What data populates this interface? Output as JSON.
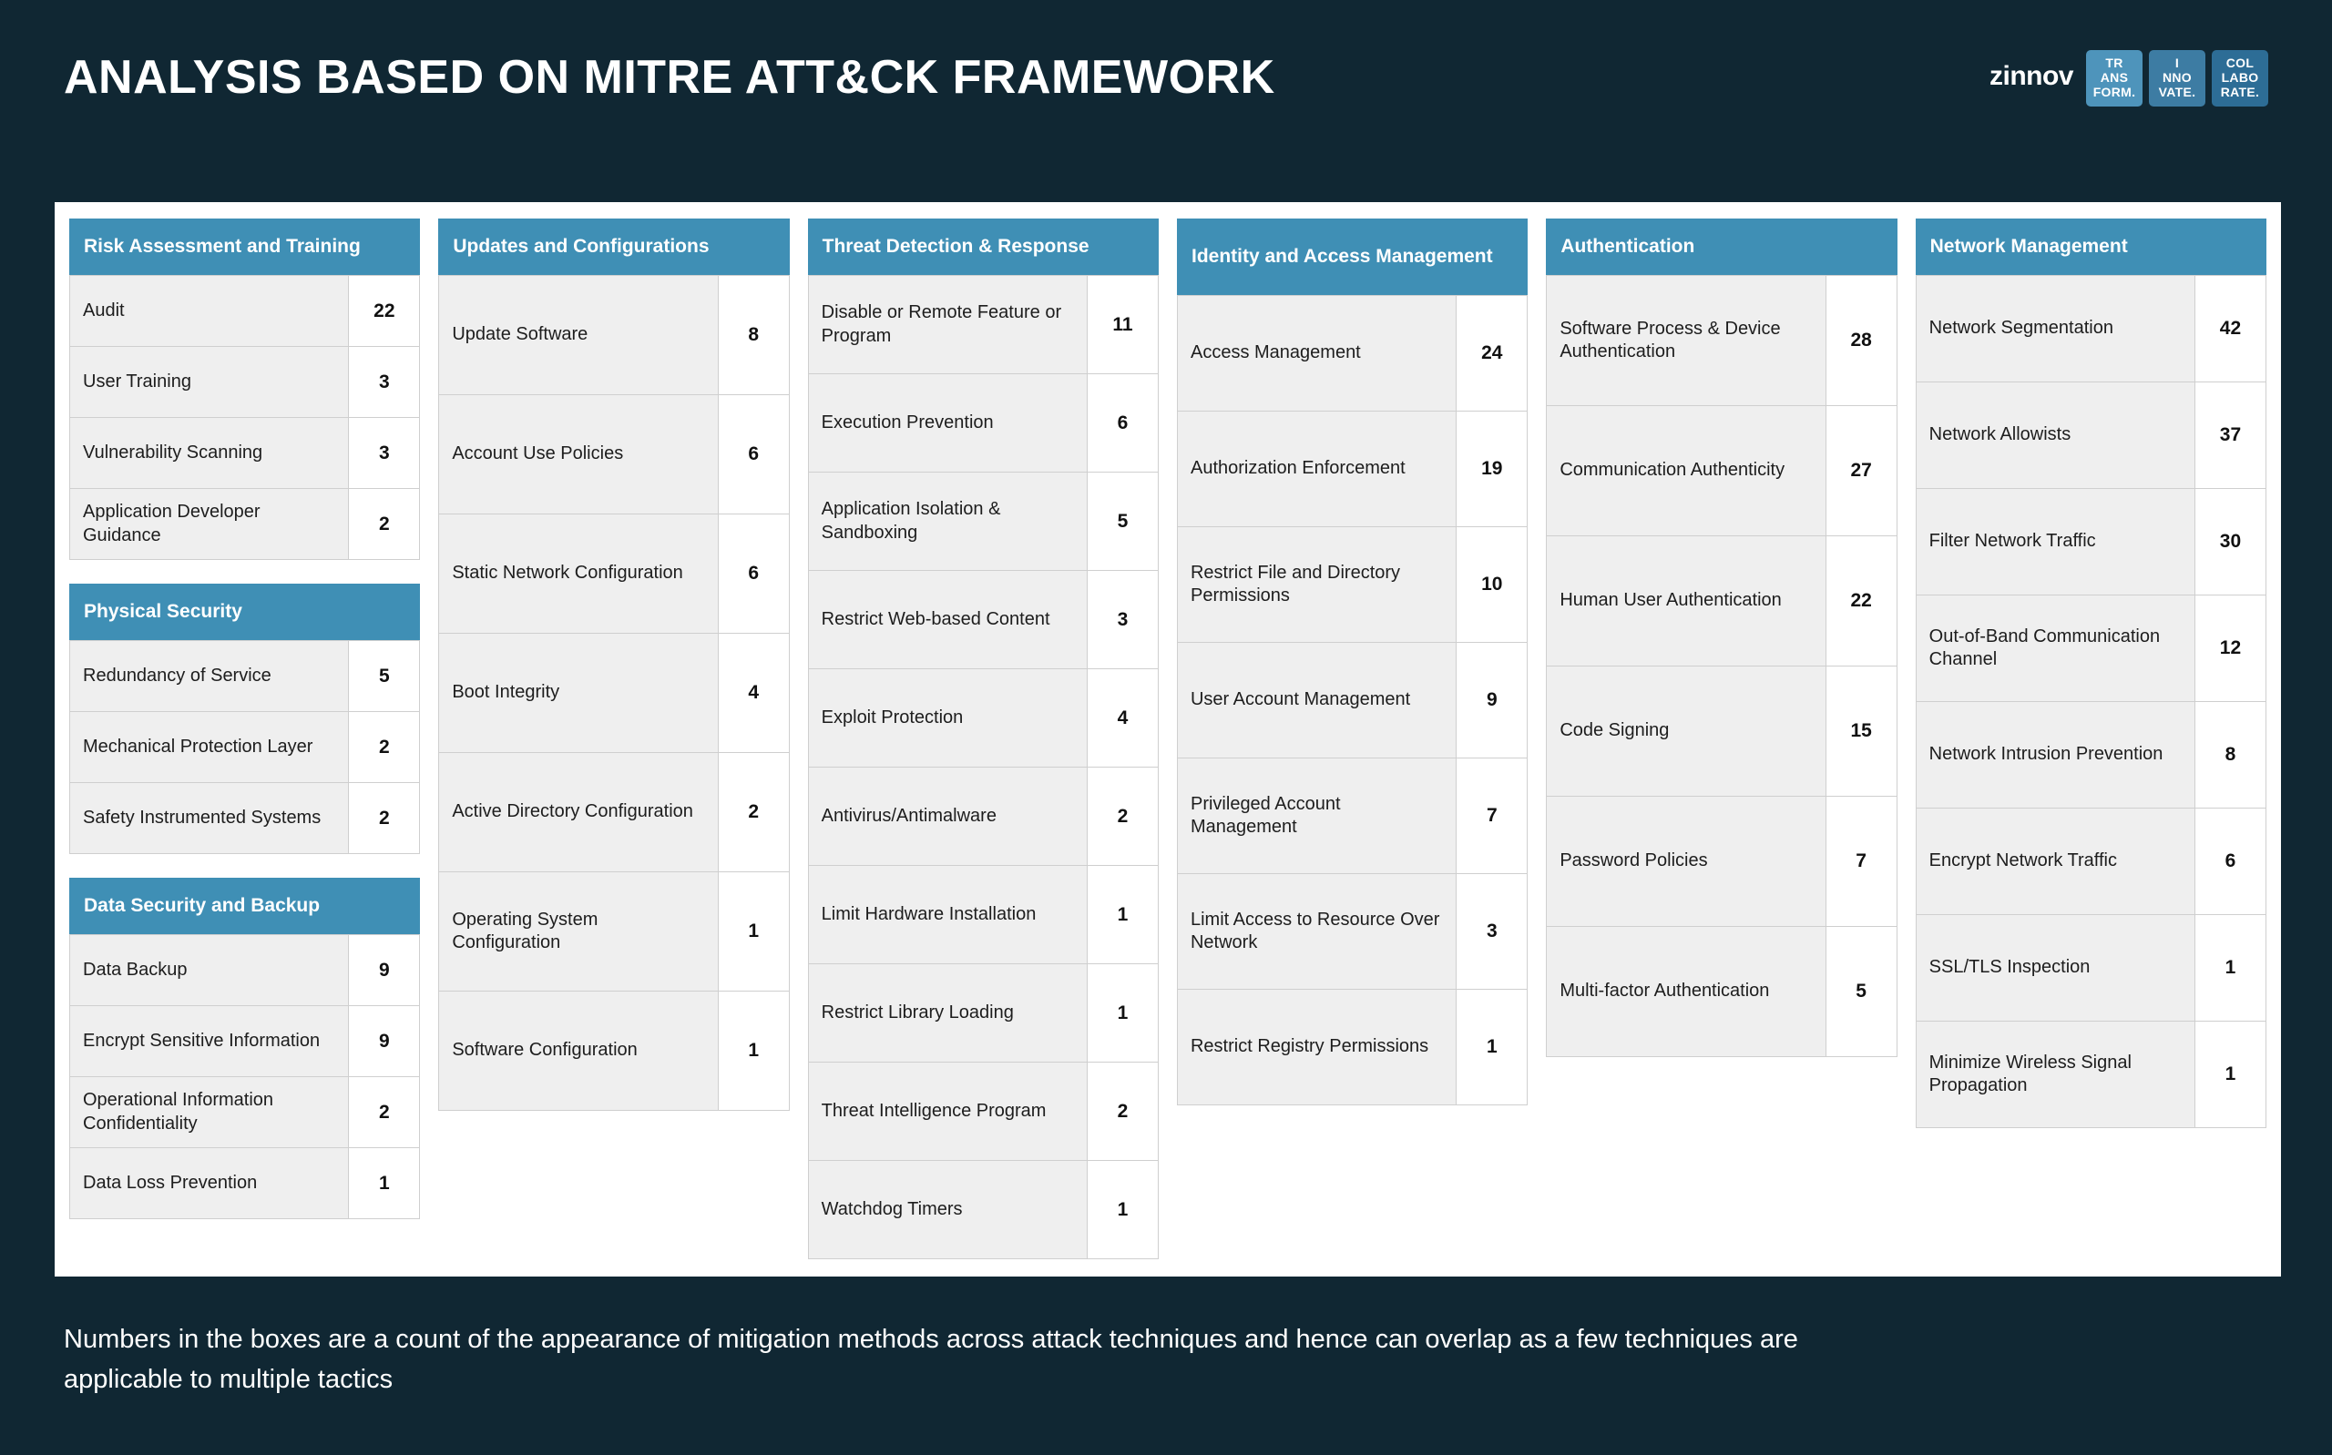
{
  "header": {
    "title": "ANALYSIS BASED ON MITRE ATT&CK FRAMEWORK",
    "brand": {
      "word": "zinnov",
      "boxes": [
        {
          "l1": "TR",
          "l2": "ANS",
          "l3": "FORM."
        },
        {
          "l1": "I",
          "l2": "NNO",
          "l3": "VATE."
        },
        {
          "l1": "COL",
          "l2": "LABO",
          "l3": "RATE."
        }
      ]
    }
  },
  "footnote": "Numbers in the boxes are a count of the appearance of mitigation methods across attack techniques and hence can overlap as a few techniques are applicable to multiple tactics",
  "colors": {
    "header_blue": "#3f8fb5",
    "background": "#102733",
    "panel": "#ffffff",
    "row_label_bg": "#efefef"
  },
  "columns": [
    {
      "groups": [
        {
          "title": "Risk Assessment and Training",
          "rows": [
            {
              "label": "Audit",
              "value": "22"
            },
            {
              "label": "User Training",
              "value": "3"
            },
            {
              "label": "Vulnerability Scanning",
              "value": "3"
            },
            {
              "label": "Application Developer Guidance",
              "value": "2"
            }
          ]
        },
        {
          "title": "Physical Security",
          "rows": [
            {
              "label": "Redundancy of Service",
              "value": "5"
            },
            {
              "label": "Mechanical Protection Layer",
              "value": "2"
            },
            {
              "label": "Safety Instrumented Systems",
              "value": "2"
            }
          ]
        },
        {
          "title": "Data Security and Backup",
          "rows": [
            {
              "label": "Data Backup",
              "value": "9"
            },
            {
              "label": "Encrypt Sensitive Information",
              "value": "9"
            },
            {
              "label": "Operational Information Confidentiality",
              "value": "2"
            },
            {
              "label": "Data Loss Prevention",
              "value": "1"
            }
          ]
        }
      ]
    },
    {
      "groups": [
        {
          "title": "Updates and Configurations",
          "rows": [
            {
              "label": "Update Software",
              "value": "8"
            },
            {
              "label": "Account Use Policies",
              "value": "6"
            },
            {
              "label": "Static Network Configuration",
              "value": "6"
            },
            {
              "label": "Boot Integrity",
              "value": "4"
            },
            {
              "label": "Active Directory Configuration",
              "value": "2"
            },
            {
              "label": "Operating System Configuration",
              "value": "1"
            },
            {
              "label": "Software Configuration",
              "value": "1"
            }
          ]
        }
      ]
    },
    {
      "groups": [
        {
          "title": "Threat Detection & Response",
          "rows": [
            {
              "label": "Disable or Remote Feature or Program",
              "value": "11"
            },
            {
              "label": "Execution Prevention",
              "value": "6"
            },
            {
              "label": "Application Isolation & Sandboxing",
              "value": "5"
            },
            {
              "label": "Restrict Web-based Content",
              "value": "3"
            },
            {
              "label": "Exploit Protection",
              "value": "4"
            },
            {
              "label": "Antivirus/Antimalware",
              "value": "2"
            },
            {
              "label": "Limit Hardware Installation",
              "value": "1"
            },
            {
              "label": "Restrict Library Loading",
              "value": "1"
            },
            {
              "label": "Threat Intelligence Program",
              "value": "2"
            },
            {
              "label": "Watchdog Timers",
              "value": "1"
            }
          ]
        }
      ]
    },
    {
      "groups": [
        {
          "title": "Identity and Access Management",
          "two_line": true,
          "rows": [
            {
              "label": "Access Management",
              "value": "24"
            },
            {
              "label": "Authorization Enforcement",
              "value": "19"
            },
            {
              "label": "Restrict File and Directory Permissions",
              "value": "10"
            },
            {
              "label": "User Account Management",
              "value": "9"
            },
            {
              "label": "Privileged Account Management",
              "value": "7"
            },
            {
              "label": "Limit Access to Resource Over Network",
              "value": "3"
            },
            {
              "label": "Restrict Registry Permissions",
              "value": "1"
            }
          ]
        }
      ]
    },
    {
      "groups": [
        {
          "title": "Authentication",
          "rows": [
            {
              "label": "Software Process & Device Authentication",
              "value": "28"
            },
            {
              "label": "Communication Authenticity",
              "value": "27"
            },
            {
              "label": "Human User Authentication",
              "value": "22"
            },
            {
              "label": "Code Signing",
              "value": "15"
            },
            {
              "label": "Password Policies",
              "value": "7"
            },
            {
              "label": "Multi-factor Authentication",
              "value": "5"
            }
          ]
        }
      ]
    },
    {
      "groups": [
        {
          "title": "Network Management",
          "rows": [
            {
              "label": "Network Segmentation",
              "value": "42"
            },
            {
              "label": "Network Allowists",
              "value": "37"
            },
            {
              "label": "Filter Network Traffic",
              "value": "30"
            },
            {
              "label": "Out-of-Band Communication Channel",
              "value": "12"
            },
            {
              "label": "Network Intrusion Prevention",
              "value": "8"
            },
            {
              "label": "Encrypt Network Traffic",
              "value": "6"
            },
            {
              "label": "SSL/TLS Inspection",
              "value": "1"
            },
            {
              "label": "Minimize Wireless Signal Propagation",
              "value": "1"
            }
          ]
        }
      ]
    }
  ]
}
